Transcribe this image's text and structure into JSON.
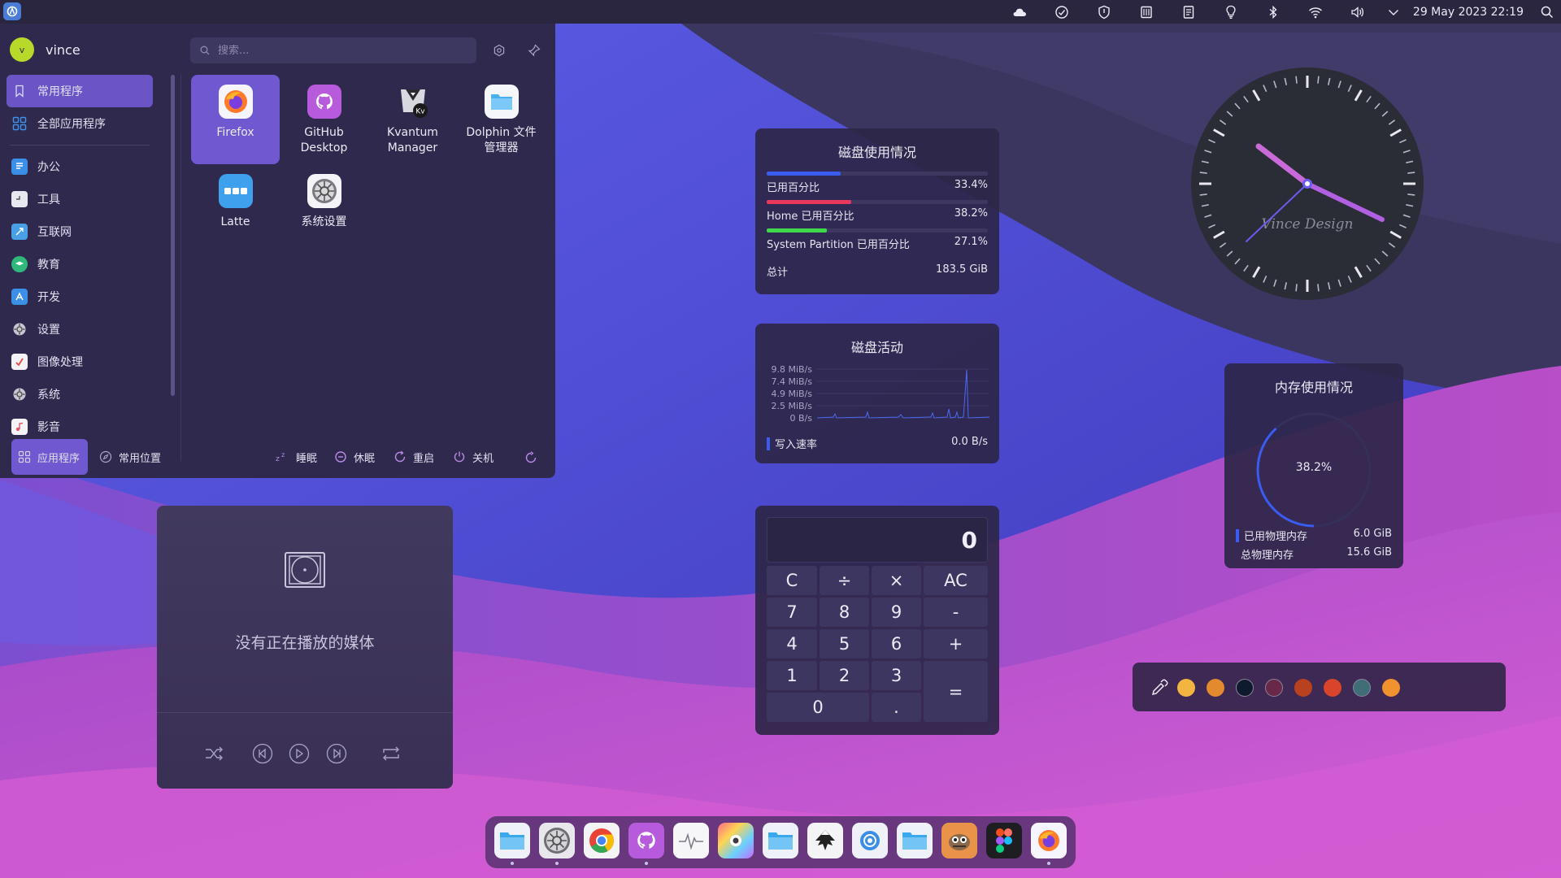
{
  "topbar": {
    "datetime": "29 May 2023  22:19",
    "tray_icons": [
      "cloud-icon",
      "update-icon",
      "shield-icon",
      "clipboard-icon",
      "notes-icon",
      "bulb-icon",
      "bluetooth-icon",
      "wifi-icon",
      "volume-icon",
      "chevron-down-icon"
    ]
  },
  "menu": {
    "username": "vince",
    "avatar_letter": "v",
    "search_placeholder": "搜索...",
    "sidebar": [
      {
        "label": "常用程序",
        "icon": "bookmark-icon",
        "color": "#6b55c6"
      },
      {
        "label": "全部应用程序",
        "icon": "grid-icon",
        "color": "#3b8fe6"
      },
      {
        "label": "办公",
        "icon": "office-icon",
        "color": "#3b8fe6"
      },
      {
        "label": "工具",
        "icon": "tools-icon",
        "color": "#e8e8f0"
      },
      {
        "label": "互联网",
        "icon": "internet-icon",
        "color": "#4aa0e6"
      },
      {
        "label": "教育",
        "icon": "education-icon",
        "color": "#2fb87a"
      },
      {
        "label": "开发",
        "icon": "develop-icon",
        "color": "#3b8fe6"
      },
      {
        "label": "设置",
        "icon": "settings-icon",
        "color": "#9a98a8"
      },
      {
        "label": "图像处理",
        "icon": "graphics-icon",
        "color": "#e8453c"
      },
      {
        "label": "系统",
        "icon": "system-icon",
        "color": "#9a98a8"
      },
      {
        "label": "影音",
        "icon": "multimedia-icon",
        "color": "#e05a6a"
      }
    ],
    "apps": [
      {
        "label": "Firefox",
        "icon": "firefox-icon"
      },
      {
        "label": "GitHub\nDesktop",
        "icon": "github-icon"
      },
      {
        "label": "Kvantum\nManager",
        "icon": "kvantum-icon"
      },
      {
        "label": "Dolphin 文件\n管理器",
        "icon": "folder-icon"
      },
      {
        "label": "Latte",
        "icon": "latte-icon"
      },
      {
        "label": "系统设置",
        "icon": "system-settings-icon"
      }
    ],
    "footer": {
      "applications": "应用程序",
      "places": "常用位置",
      "sleep": "睡眠",
      "hibernate": "休眠",
      "restart": "重启",
      "shutdown": "关机"
    }
  },
  "disk_usage": {
    "title": "磁盘使用情况",
    "rows": [
      {
        "label": "已用百分比",
        "value": "33.4%",
        "pct": 33.4,
        "color": "#3b5cf0"
      },
      {
        "label": "Home 已用百分比",
        "value": "38.2%",
        "pct": 38.2,
        "color": "#e8385c"
      },
      {
        "label": "System Partition 已用百分比",
        "value": "27.1%",
        "pct": 27.1,
        "color": "#3fd84a"
      }
    ],
    "total_label": "总计",
    "total_value": "183.5 GiB"
  },
  "disk_activity": {
    "title": "磁盘活动",
    "ticks": [
      "9.8 MiB/s",
      "7.4 MiB/s",
      "4.9 MiB/s",
      "2.5 MiB/s",
      "0 B/s"
    ],
    "legend_label": "写入速率",
    "legend_value": "0.0 B/s",
    "legend_color": "#3b5cf0"
  },
  "media": {
    "message": "没有正在播放的媒体"
  },
  "calculator": {
    "display": "0",
    "buttons": [
      {
        "label": "C"
      },
      {
        "label": "÷"
      },
      {
        "label": "×"
      },
      {
        "label": "AC"
      },
      {
        "label": "7"
      },
      {
        "label": "8"
      },
      {
        "label": "9"
      },
      {
        "label": "-"
      },
      {
        "label": "4"
      },
      {
        "label": "5"
      },
      {
        "label": "6"
      },
      {
        "label": "+"
      },
      {
        "label": "1"
      },
      {
        "label": "2"
      },
      {
        "label": "3"
      },
      {
        "label": "="
      },
      {
        "label": "0"
      },
      {
        "label": "."
      }
    ]
  },
  "clock": {
    "brand": "Vince Design",
    "hour_hand_color": "#c86ad8",
    "minute_hand_color": "#c86ad8",
    "second_hand_color": "#6a5cf0"
  },
  "memory": {
    "title": "内存使用情况",
    "percent_label": "38.2%",
    "percent": 38.2,
    "used_label": "已用物理内存",
    "used_value": "6.0 GiB",
    "total_label": "总物理内存",
    "total_value": "15.6 GiB",
    "ring_color": "#3b5cf0"
  },
  "color_picker": {
    "colors": [
      "#f2b542",
      "#e38a2e",
      "#0e1a2e",
      "#6a2848",
      "#b8421e",
      "#d8452a",
      "#3f6e78",
      "#f0922e"
    ]
  },
  "dock": {
    "items": [
      "folder-icon",
      "system-settings-icon",
      "chrome-icon",
      "github-icon",
      "system-monitor-icon",
      "photos-icon",
      "folder-icon",
      "inkscape-icon",
      "krunner-icon",
      "folder-icon",
      "gimp-icon",
      "figma-icon",
      "firefox-icon"
    ]
  }
}
